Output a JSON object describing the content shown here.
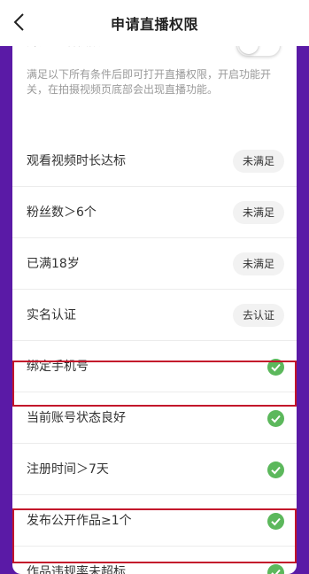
{
  "header": {
    "title": "申请直播权限"
  },
  "toggle": {
    "label": "开通直播权限"
  },
  "description": "满足以下所有条件后即可打开直播权限，开启功能开关，在拍摄视频页底部会出现直播功能。",
  "conditions": [
    {
      "label": "观看视频时长达标",
      "status": "未满足"
    },
    {
      "label": "粉丝数＞6个",
      "status": "未满足"
    },
    {
      "label": "已满18岁",
      "status": "未满足"
    },
    {
      "label": "实名认证",
      "status": "去认证"
    },
    {
      "label": "绑定手机号",
      "status": "check-icon"
    },
    {
      "label": "当前账号状态良好",
      "status": "check-icon"
    },
    {
      "label": "注册时间＞7天",
      "status": "check-icon"
    },
    {
      "label": "发布公开作品≥1个",
      "status": "check-icon"
    },
    {
      "label": "作品违规率未超标",
      "status": "check-icon"
    }
  ],
  "colors": {
    "background": "#5a1aa6",
    "check": "#5cb85c",
    "highlight": "#c3142b"
  }
}
